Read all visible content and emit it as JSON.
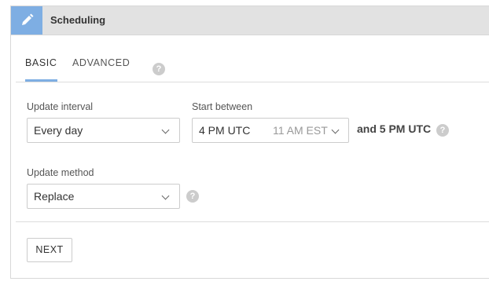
{
  "header": {
    "title": "Scheduling",
    "icon": "pencil-icon",
    "accent_color": "#7eaee3"
  },
  "tabs": [
    {
      "label": "BASIC",
      "active": true
    },
    {
      "label": "ADVANCED",
      "active": false
    }
  ],
  "tabs_help": "?",
  "update_interval": {
    "label": "Update interval",
    "value": "Every day"
  },
  "start_between": {
    "label": "Start between",
    "value": "4 PM UTC",
    "secondary": "11 AM EST",
    "and_text": "and 5 PM UTC",
    "help": "?"
  },
  "update_method": {
    "label": "Update method",
    "value": "Replace",
    "help": "?"
  },
  "next_button": {
    "label": "NEXT"
  }
}
